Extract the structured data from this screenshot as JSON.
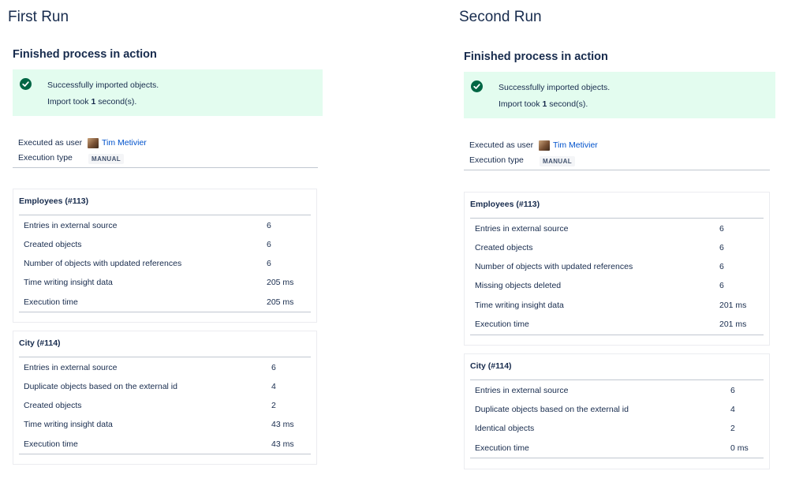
{
  "runs": [
    {
      "title": "First Run",
      "subtitle": "Finished process in action",
      "success": {
        "line1": "Successfully imported objects.",
        "line2_prefix": "Import took ",
        "line2_bold": "1",
        "line2_suffix": " second(s)."
      },
      "meta": {
        "executed_as_label": "Executed as user",
        "user_name": "Tim Metivier",
        "execution_type_label": "Execution type",
        "execution_type": "MANUAL"
      },
      "cards": [
        {
          "title": "Employees (#113)",
          "rows": [
            {
              "label": "Entries in external source",
              "value": "6"
            },
            {
              "label": "Created objects",
              "value": "6"
            },
            {
              "label": "Number of objects with updated references",
              "value": "6"
            },
            {
              "label": "Time writing insight data",
              "value": "205 ms"
            },
            {
              "label": "Execution time",
              "value": "205 ms"
            }
          ]
        },
        {
          "title": "City (#114)",
          "rows": [
            {
              "label": "Entries in external source",
              "value": "6"
            },
            {
              "label": "Duplicate objects based on the external id",
              "value": "4"
            },
            {
              "label": "Created objects",
              "value": "2"
            },
            {
              "label": "Time writing insight data",
              "value": "43 ms"
            },
            {
              "label": "Execution time",
              "value": "43 ms"
            }
          ]
        }
      ]
    },
    {
      "title": "Second Run",
      "subtitle": "Finished process in action",
      "success": {
        "line1": "Successfully imported objects.",
        "line2_prefix": "Import took ",
        "line2_bold": "1",
        "line2_suffix": " second(s)."
      },
      "meta": {
        "executed_as_label": "Executed as user",
        "user_name": "Tim Metivier",
        "execution_type_label": "Execution type",
        "execution_type": "MANUAL"
      },
      "cards": [
        {
          "title": "Employees (#113)",
          "rows": [
            {
              "label": "Entries in external source",
              "value": "6"
            },
            {
              "label": "Created objects",
              "value": "6"
            },
            {
              "label": "Number of objects with updated references",
              "value": "6"
            },
            {
              "label": "Missing objects deleted",
              "value": "6"
            },
            {
              "label": "Time writing insight data",
              "value": "201 ms"
            },
            {
              "label": "Execution time",
              "value": "201 ms"
            }
          ]
        },
        {
          "title": "City (#114)",
          "rows": [
            {
              "label": "Entries in external source",
              "value": "6"
            },
            {
              "label": "Duplicate objects based on the external id",
              "value": "4"
            },
            {
              "label": "Identical objects",
              "value": "2"
            },
            {
              "label": "Execution time",
              "value": "0 ms"
            }
          ]
        }
      ]
    }
  ],
  "colors": {
    "success_bg": "#e3fcef",
    "success_icon": "#006644",
    "link": "#0052cc",
    "text": "#172b4d",
    "divider": "#c1c7d0"
  },
  "icons": {
    "success": "check-circle-icon",
    "avatar": "user-avatar-icon"
  }
}
